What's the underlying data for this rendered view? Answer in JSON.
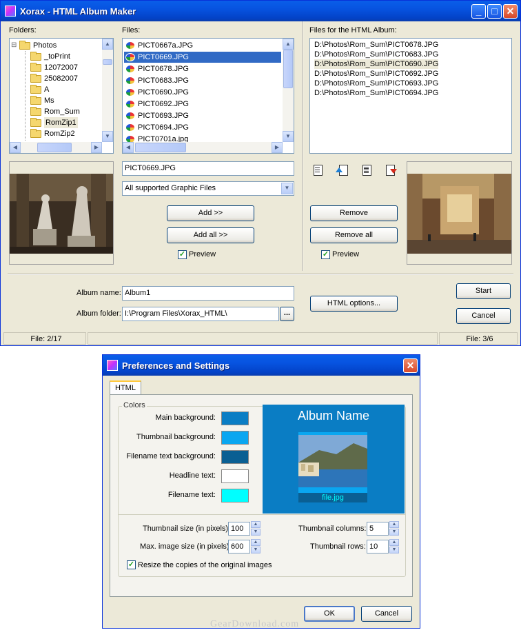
{
  "main_window": {
    "title": "Xorax - HTML Album Maker",
    "folders_label": "Folders:",
    "files_label": "Files:",
    "album_files_label": "Files for the HTML Album:",
    "tree": [
      {
        "label": "Photos",
        "expander": "⊟"
      },
      {
        "label": "_toPrint"
      },
      {
        "label": "12072007"
      },
      {
        "label": "25082007"
      },
      {
        "label": "A"
      },
      {
        "label": "Ms"
      },
      {
        "label": "Rom_Sum"
      },
      {
        "label": "RomZip1"
      },
      {
        "label": "RomZip2"
      }
    ],
    "files": [
      "PICT0667a.JPG",
      "PICT0669.JPG",
      "PICT0678.JPG",
      "PICT0683.JPG",
      "PICT0690.JPG",
      "PICT0692.JPG",
      "PICT0693.JPG",
      "PICT0694.JPG",
      "PICT0701a.jpg"
    ],
    "album_files": [
      "D:\\Photos\\Rom_Sum\\PICT0678.JPG",
      "D:\\Photos\\Rom_Sum\\PICT0683.JPG",
      "D:\\Photos\\Rom_Sum\\PICT0690.JPG",
      "D:\\Photos\\Rom_Sum\\PICT0692.JPG",
      "D:\\Photos\\Rom_Sum\\PICT0693.JPG",
      "D:\\Photos\\Rom_Sum\\PICT0694.JPG"
    ],
    "filename_field": "PICT0669.JPG",
    "filter_select": "All supported Graphic Files",
    "add_label": "Add >>",
    "add_all_label": "Add all >>",
    "remove_label": "Remove",
    "remove_all_label": "Remove all",
    "preview_label": "Preview",
    "album_name_label": "Album name:",
    "album_name_value": "Album1",
    "album_folder_label": "Album folder:",
    "album_folder_value": "I:\\Program Files\\Xorax_HTML\\",
    "browse_label": "...",
    "html_options_label": "HTML options...",
    "start_label": "Start",
    "cancel_label": "Cancel",
    "status_left": "File: 2/17",
    "status_right": "File: 3/6"
  },
  "prefs_window": {
    "title": "Preferences and Settings",
    "tab_html": "HTML",
    "colors_group": "Colors",
    "color_rows": [
      {
        "label": "Main background:",
        "color": "#0a7dc4"
      },
      {
        "label": "Thumbnail background:",
        "color": "#0aa6f0"
      },
      {
        "label": "Filename text background:",
        "color": "#0a5f93"
      },
      {
        "label": "Headline text:",
        "color": "#ffffff"
      },
      {
        "label": "Filename text:",
        "color": "#00ffff"
      }
    ],
    "preview_title": "Album Name",
    "preview_filename": "file.jpg",
    "thumb_size_label": "Thumbnail size (in pixels):",
    "thumb_size_value": "100",
    "max_image_label": "Max. image size (in pixels):",
    "max_image_value": "600",
    "thumb_columns_label": "Thumbnail columns:",
    "thumb_columns_value": "5",
    "thumb_rows_label": "Thumbnail rows:",
    "thumb_rows_value": "10",
    "resize_label": "Resize the copies of the original images",
    "ok_label": "OK",
    "cancel_label": "Cancel"
  },
  "watermark": "GearDownload.com"
}
